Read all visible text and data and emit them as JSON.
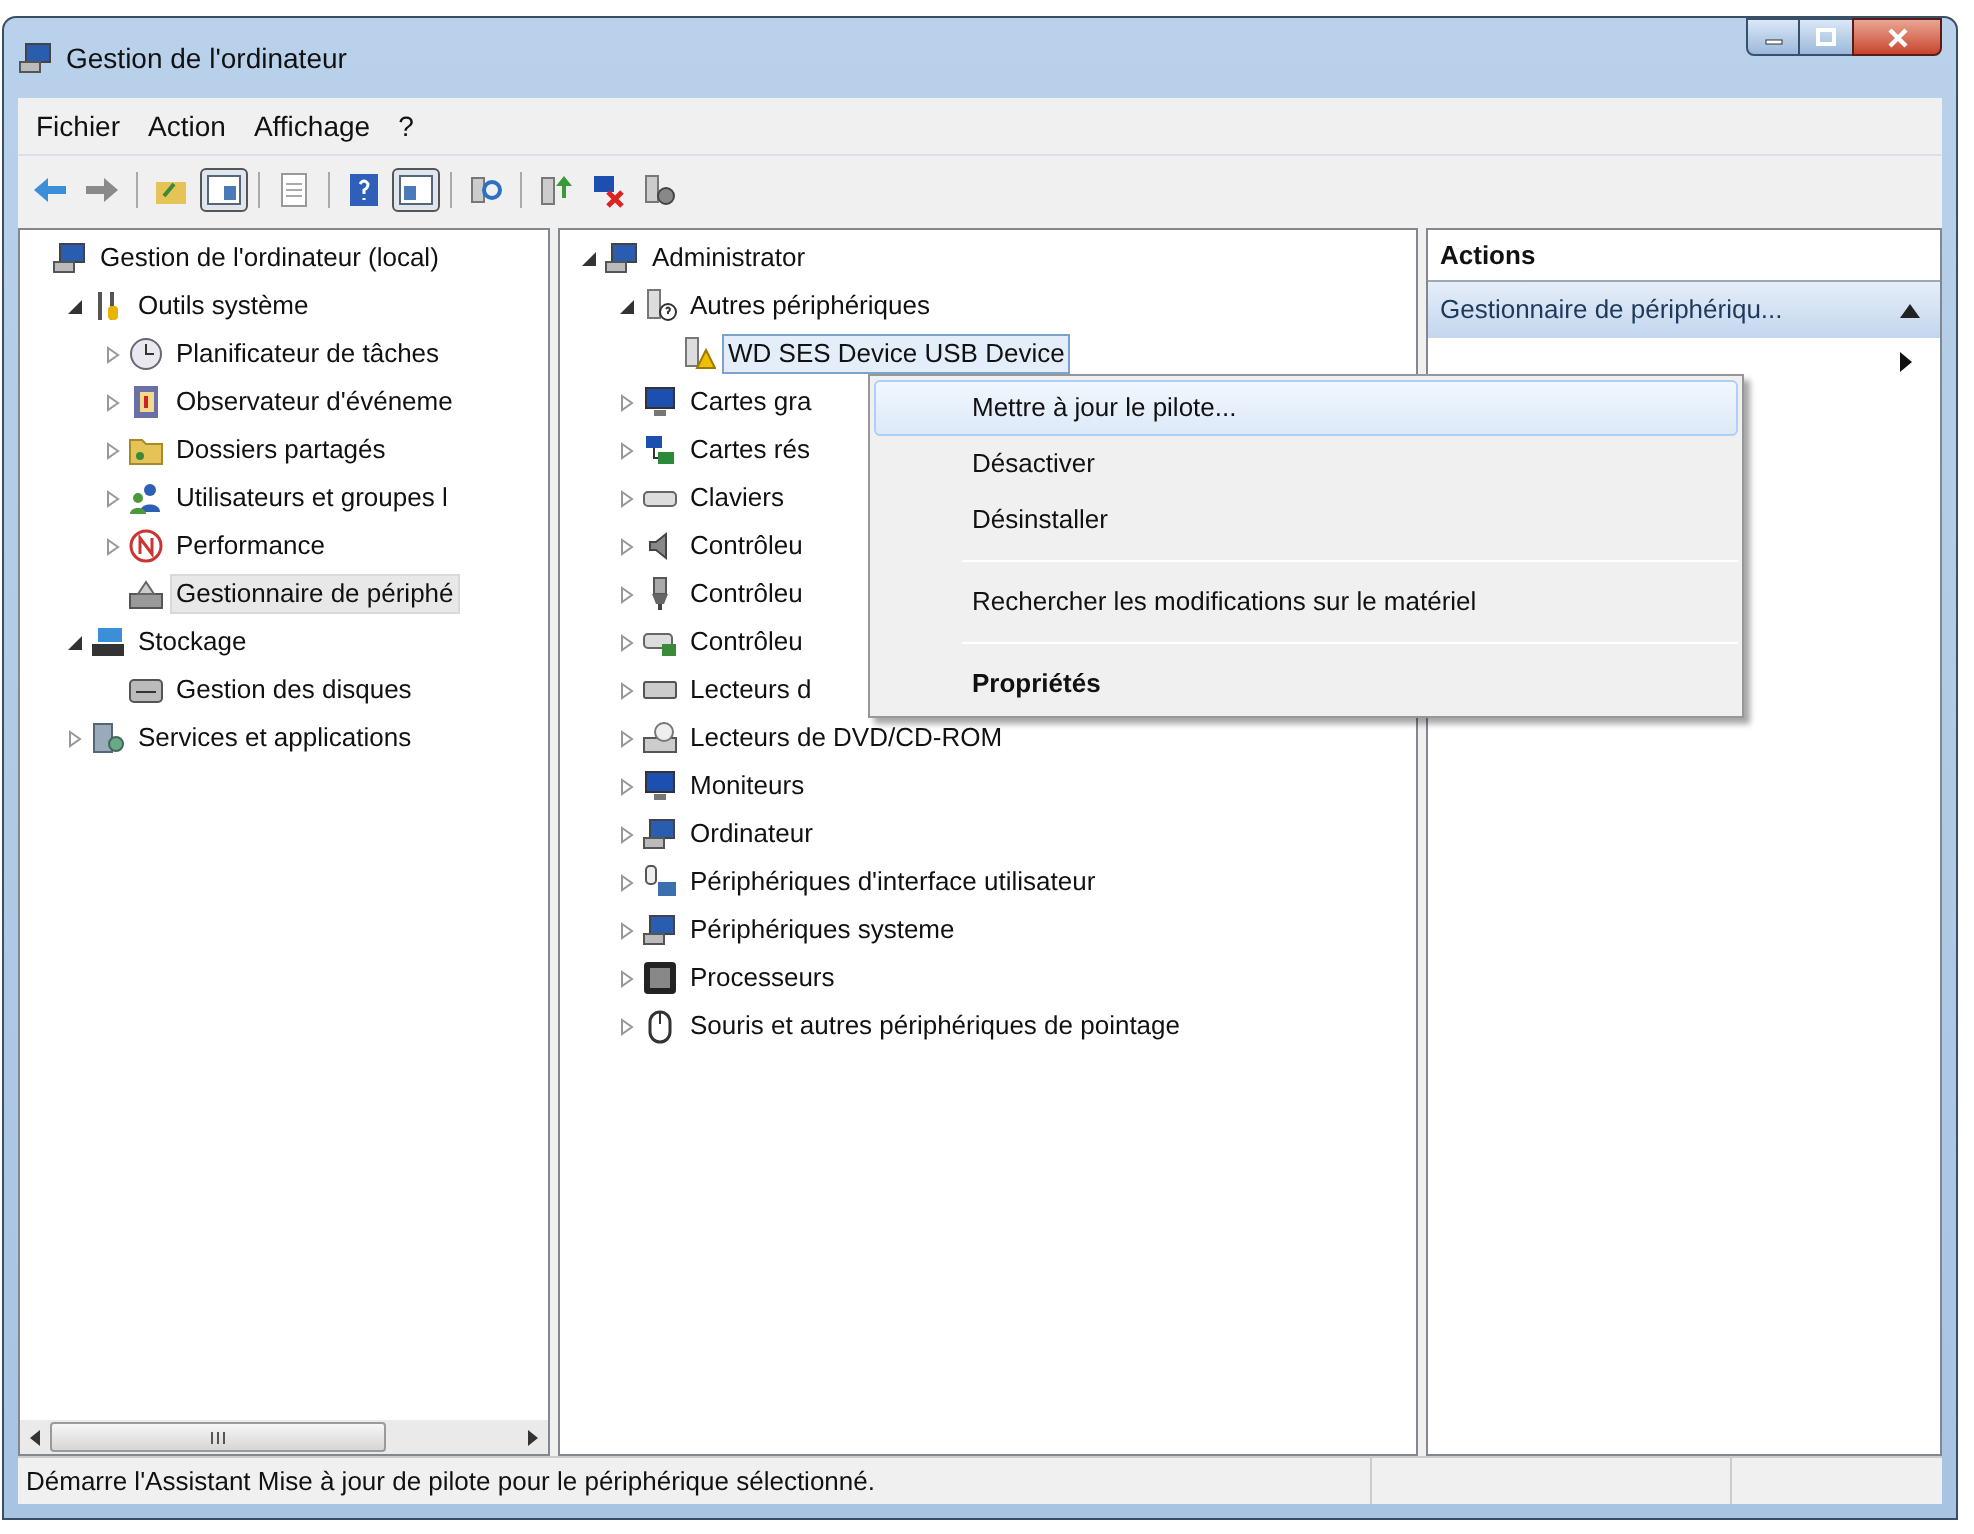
{
  "window": {
    "title": "Gestion de l'ordinateur"
  },
  "menu": [
    "Fichier",
    "Action",
    "Affichage",
    "?"
  ],
  "toolbar": [
    {
      "kind": "button",
      "pressed": false
    },
    {
      "kind": "button",
      "pressed": false
    },
    {
      "kind": "separator"
    },
    {
      "kind": "button",
      "pressed": false
    },
    {
      "kind": "button",
      "pressed": true
    },
    {
      "kind": "separator"
    },
    {
      "kind": "button",
      "pressed": false
    },
    {
      "kind": "separator"
    },
    {
      "kind": "button",
      "pressed": false
    },
    {
      "kind": "button",
      "pressed": true
    },
    {
      "kind": "separator"
    },
    {
      "kind": "button",
      "pressed": false
    },
    {
      "kind": "separator"
    },
    {
      "kind": "button",
      "pressed": false
    },
    {
      "kind": "button",
      "pressed": false
    },
    {
      "kind": "button",
      "pressed": false
    }
  ],
  "console_tree": [
    {
      "label": "Gestion de l'ordinateur (local)",
      "selected": false,
      "children": [
        {
          "label": "Outils système",
          "selected": false,
          "expanded": true,
          "children": [
            {
              "label": "Planificateur de tâches",
              "selected": false,
              "expanded": false
            },
            {
              "label": "Observateur d'événeme",
              "selected": false,
              "expanded": false
            },
            {
              "label": "Dossiers partagés",
              "selected": false,
              "expanded": false
            },
            {
              "label": "Utilisateurs et groupes l",
              "selected": false,
              "expanded": false
            },
            {
              "label": "Performance",
              "selected": false,
              "expanded": false
            },
            {
              "label": "Gestionnaire de périphé",
              "selected": true
            }
          ]
        },
        {
          "label": "Stockage",
          "selected": false,
          "expanded": true,
          "children": [
            {
              "label": "Gestion des disques",
              "selected": false
            }
          ]
        },
        {
          "label": "Services et applications",
          "selected": false,
          "expanded": false
        }
      ]
    }
  ],
  "device_tree": [
    {
      "label": "Administrator",
      "selected": false,
      "expanded": true,
      "children": [
        {
          "label": "Autres périphériques",
          "selected": false,
          "expanded": true,
          "children": [
            {
              "label": "WD SES Device USB Device",
              "selected": true
            }
          ]
        },
        {
          "label": "Cartes gra",
          "selected": false,
          "expanded": false
        },
        {
          "label": "Cartes rés",
          "selected": false,
          "expanded": false
        },
        {
          "label": "Claviers",
          "selected": false,
          "expanded": false
        },
        {
          "label": "Contrôleu",
          "selected": false,
          "expanded": false
        },
        {
          "label": "Contrôleu",
          "selected": false,
          "expanded": false
        },
        {
          "label": "Contrôleu",
          "selected": false,
          "expanded": false
        },
        {
          "label": "Lecteurs d",
          "selected": false,
          "expanded": false
        },
        {
          "label": "Lecteurs de DVD/CD-ROM",
          "selected": false,
          "expanded": false
        },
        {
          "label": "Moniteurs",
          "selected": false,
          "expanded": false
        },
        {
          "label": "Ordinateur",
          "selected": false,
          "expanded": false
        },
        {
          "label": "Périphériques d'interface utilisateur",
          "selected": false,
          "expanded": false
        },
        {
          "label": "Périphériques systeme",
          "selected": false,
          "expanded": false
        },
        {
          "label": "Processeurs",
          "selected": false,
          "expanded": false
        },
        {
          "label": "Souris et autres périphériques de pointage",
          "selected": false,
          "expanded": false
        }
      ]
    }
  ],
  "actions_pane": {
    "title": "Actions",
    "section": {
      "label": "Gestionnaire de périphériqu...",
      "expanded": true
    }
  },
  "context_menu": [
    {
      "kind": "item",
      "label": "Mettre à jour le pilote...",
      "selected": true,
      "default": false
    },
    {
      "kind": "item",
      "label": "Désactiver",
      "selected": false,
      "default": false
    },
    {
      "kind": "item",
      "label": "Désinstaller",
      "selected": false,
      "default": false
    },
    {
      "kind": "separator"
    },
    {
      "kind": "item",
      "label": "Rechercher les modifications sur le matériel",
      "selected": false,
      "default": false
    },
    {
      "kind": "separator"
    },
    {
      "kind": "item",
      "label": "Propriétés",
      "selected": false,
      "default": true
    }
  ],
  "status_bar": {
    "text": "Démarre l'Assistant Mise à jour de pilote pour le périphérique sélectionné."
  }
}
